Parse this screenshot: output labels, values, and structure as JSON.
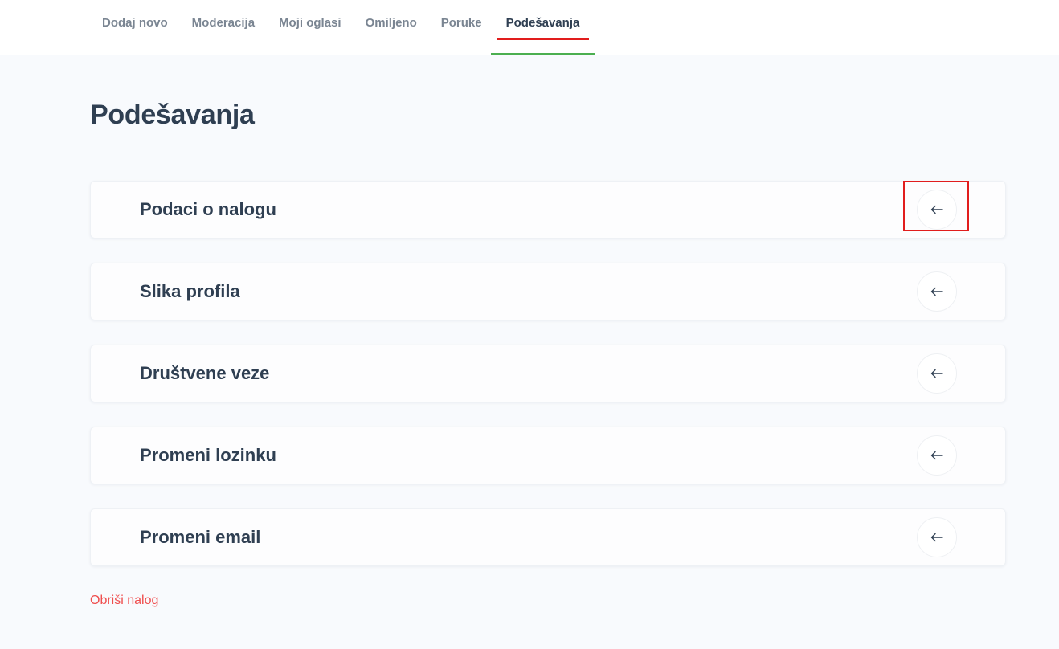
{
  "nav": {
    "tabs": [
      {
        "label": "Dodaj novo"
      },
      {
        "label": "Moderacija"
      },
      {
        "label": "Moji oglasi"
      },
      {
        "label": "Omiljeno"
      },
      {
        "label": "Poruke"
      },
      {
        "label": "Podešavanja",
        "active": true
      }
    ]
  },
  "page": {
    "title": "Podešavanja"
  },
  "settings": {
    "items": [
      {
        "label": "Podaci o nalogu",
        "icon": "arrow-left-icon"
      },
      {
        "label": "Slika profila",
        "icon": "arrow-left-icon"
      },
      {
        "label": "Društvene veze",
        "icon": "arrow-left-icon"
      },
      {
        "label": "Promeni lozinku",
        "icon": "arrow-left-icon"
      },
      {
        "label": "Promeni email",
        "icon": "arrow-left-icon"
      }
    ]
  },
  "footer": {
    "delete_account_label": "Obriši nalog"
  },
  "colors": {
    "accent_green": "#4caf50",
    "highlight_red": "#e11d1d",
    "danger_text": "#ef4e4e",
    "heading_text": "#2f3f52",
    "muted_text": "#7a8592",
    "background": "#f8fafd"
  }
}
